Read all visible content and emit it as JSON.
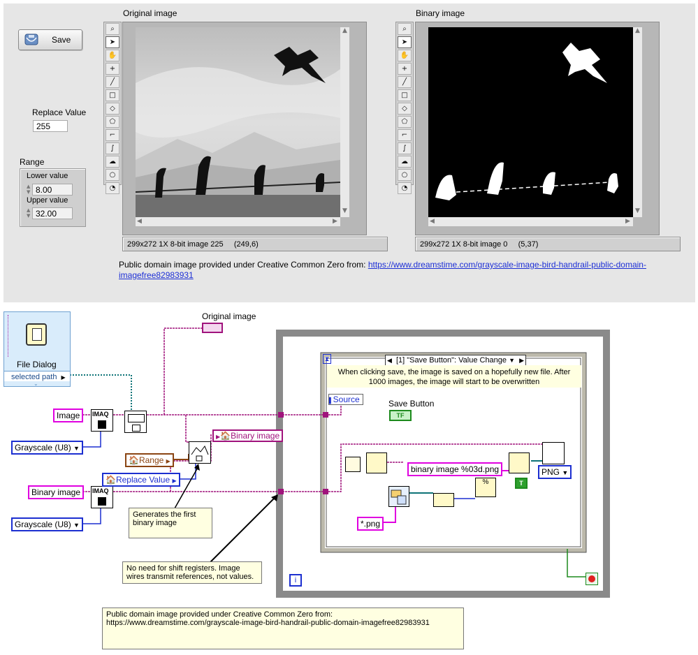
{
  "front_panel": {
    "save_button_label": "Save",
    "replace_value": {
      "label": "Replace Value",
      "value": "255"
    },
    "range": {
      "label": "Range",
      "lower_label": "Lower value",
      "lower_value": "8.00",
      "upper_label": "Upper value",
      "upper_value": "32.00"
    },
    "original_image": {
      "title": "Original image",
      "status": "299x272 1X 8-bit image 225     (249,6)"
    },
    "binary_image": {
      "title": "Binary image",
      "status": "299x272 1X 8-bit image 0     (5,37)"
    },
    "credit_prefix": "Public domain image provided under Creative Common Zero from: ",
    "credit_link": "https://www.dreamstime.com/grayscale-image-bird-handrail-public-domain-imagefree82983931",
    "palette_tools": [
      "zoom-icon",
      "pointer-icon",
      "pan-icon",
      "point-icon",
      "line-icon",
      "rectangle-icon",
      "rotated-rectangle-icon",
      "polygon-icon",
      "broken-line-icon",
      "freehand-line-icon",
      "freehand-region-icon",
      "oval-icon",
      "annulus-icon"
    ]
  },
  "block_diagram": {
    "file_dialog": {
      "title": "File Dialog",
      "output": "selected path"
    },
    "original_image_indicator": "Original image",
    "image_const": "Image",
    "binary_image_const": "Binary image",
    "grayscale_1": "Grayscale (U8)",
    "grayscale_2": "Grayscale (U8)",
    "range_local": "Range",
    "replace_value_local": "Replace Value",
    "binary_image_indicator": "Binary image",
    "imaq_label": "IMAQ",
    "note_first_binary": "Generates the first binary image",
    "note_shift_registers": "No need for shift registers. Image wires transmit references, not values.",
    "note_credit": "Public domain image provided under Creative Common Zero from: https://www.dreamstime.com/grayscale-image-bird-handrail-public-domain-imagefree82983931",
    "event_case": "[1] \"Save Button\": Value Change",
    "event_comment": "When clicking save, the image is saved on a hopefully new file. After 1000 images, the image will start to be overwritten",
    "source_label": "Source",
    "save_button_terminal": "Save Button",
    "tf_label": "TF",
    "format_string": "binary image %03d.png",
    "pattern_string": "*.png",
    "format_enum": "PNG",
    "true_const": "T",
    "loop_index": "i",
    "timeout_label": "⧗"
  },
  "colors": {
    "panel_bg": "#e6e6e6",
    "image_wire": "#a0137c",
    "path_wire": "#0d7377",
    "cluster_wire": "#8b4513",
    "numeric_wire": "#1c2fd0",
    "boolean_wire": "#1d8a1d",
    "string_wire": "#e000e0"
  }
}
